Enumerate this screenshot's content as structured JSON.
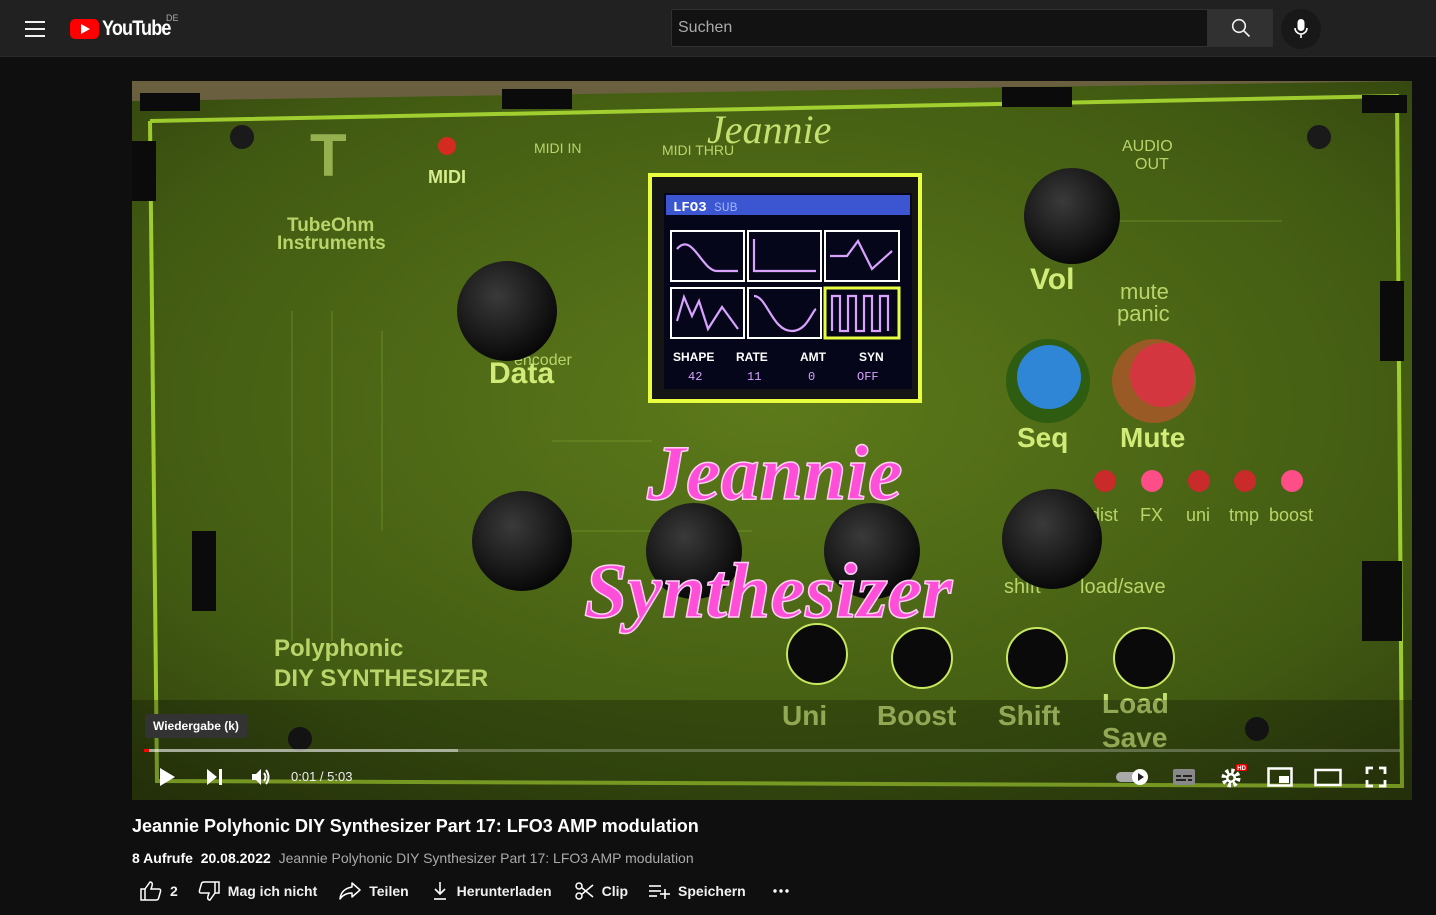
{
  "masthead": {
    "logo_text": "YouTube",
    "region": "DE",
    "search_placeholder": "Suchen"
  },
  "player": {
    "overlay_title_line1": "Jeannie",
    "overlay_title_line2": "Synthesizer",
    "tooltip": "Wiedergabe (k)",
    "time": "0:01 / 5:03",
    "progress": 0.004,
    "buffered": 0.25,
    "screen": {
      "header": "LFO3",
      "sub": "SUB",
      "params": [
        {
          "label": "SHAPE",
          "value": "42"
        },
        {
          "label": "RATE",
          "value": "11"
        },
        {
          "label": "AMT",
          "value": "0"
        },
        {
          "label": "SYN",
          "value": "OFF"
        }
      ]
    },
    "board_labels": {
      "brand": "TubeOhm",
      "brand2": "Instruments",
      "midi": "MIDI",
      "midi_in": "MIDI IN",
      "midi_thru": "MIDI THRU",
      "jeannie": "Jeannie",
      "audio": "AUDIO",
      "out": "OUT",
      "vol": "Vol",
      "mute1": "mute",
      "mute2": "panic",
      "seq": "Seq",
      "mute": "Mute",
      "data": "Data",
      "encoder": "encoder",
      "leds": [
        "dist",
        "FX",
        "uni",
        "tmp",
        "boost"
      ],
      "poly1": "Polyphonic",
      "poly2": "DIY SYNTHESIZER",
      "buttons": [
        "Uni",
        "Boost",
        "Shift",
        "Load"
      ],
      "save": "Save",
      "shift_top": "shift",
      "load_top": "load/save"
    }
  },
  "video": {
    "title": "Jeannie Polyhonic DIY Synthesizer Part 17: LFO3 AMP modulation",
    "views": "8 Aufrufe",
    "date": "20.08.2022",
    "description": "Jeannie Polyhonic DIY Synthesizer  Part 17:  LFO3  AMP modulation"
  },
  "actions": {
    "likes": "2",
    "dislike": "Mag ich nicht",
    "share": "Teilen",
    "download": "Herunterladen",
    "clip": "Clip",
    "save": "Speichern"
  }
}
